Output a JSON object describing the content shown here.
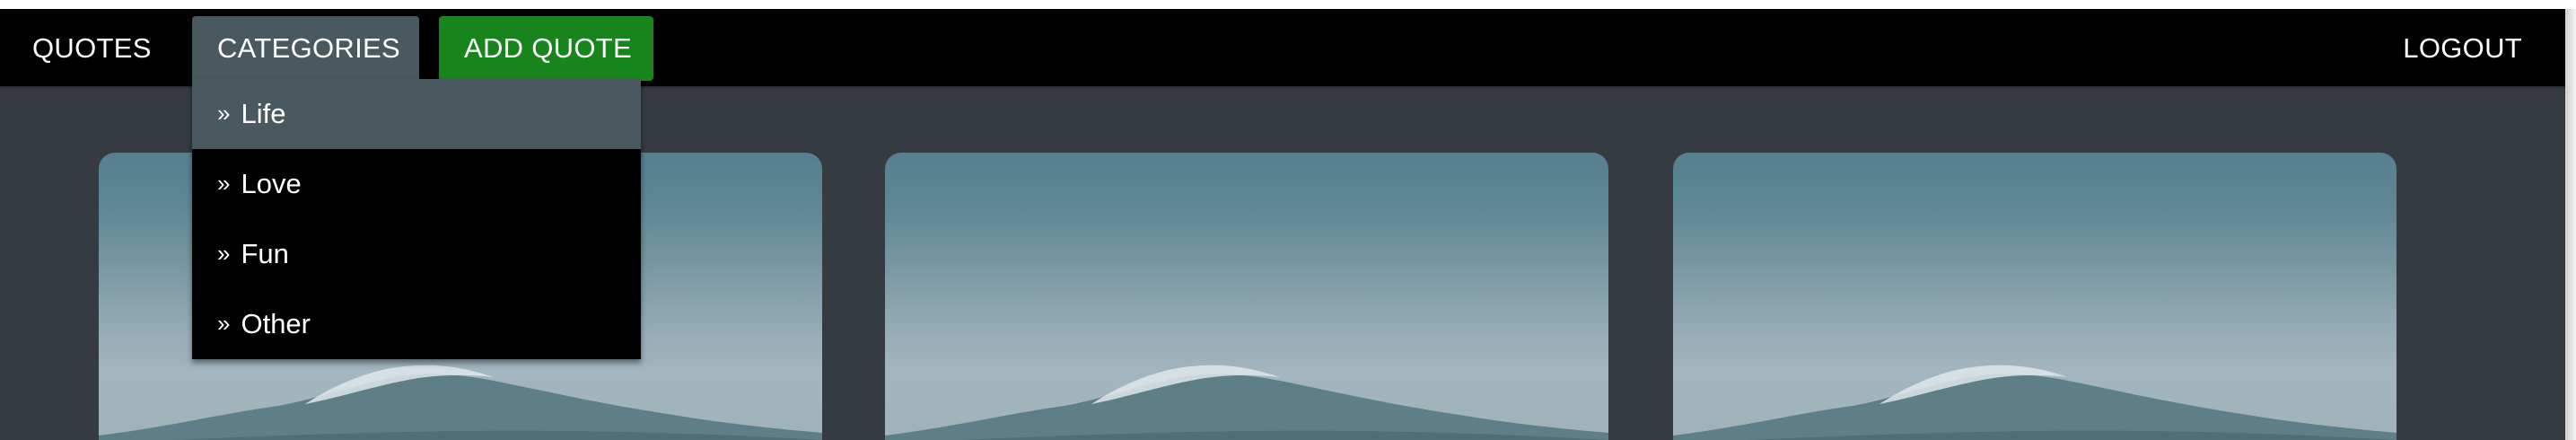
{
  "navbar": {
    "quotes_label": "QUOTES",
    "categories_label": "CATEGORIES",
    "add_quote_label": "ADD QUOTE",
    "logout_label": "LOGOUT"
  },
  "dropdown": {
    "bullet": "»",
    "items": [
      {
        "label": "Life",
        "active": true
      },
      {
        "label": "Love",
        "active": false
      },
      {
        "label": "Fun",
        "active": false
      },
      {
        "label": "Other",
        "active": false
      }
    ]
  },
  "colors": {
    "navbar_bg": "#000000",
    "page_bg": "#353b40",
    "categories_active_bg": "#4a5960",
    "add_quote_bg": "#18841c",
    "text": "#ffffff"
  },
  "cards": [
    {
      "image": "mountain-landscape"
    },
    {
      "image": "mountain-landscape"
    },
    {
      "image": "mountain-landscape"
    }
  ]
}
